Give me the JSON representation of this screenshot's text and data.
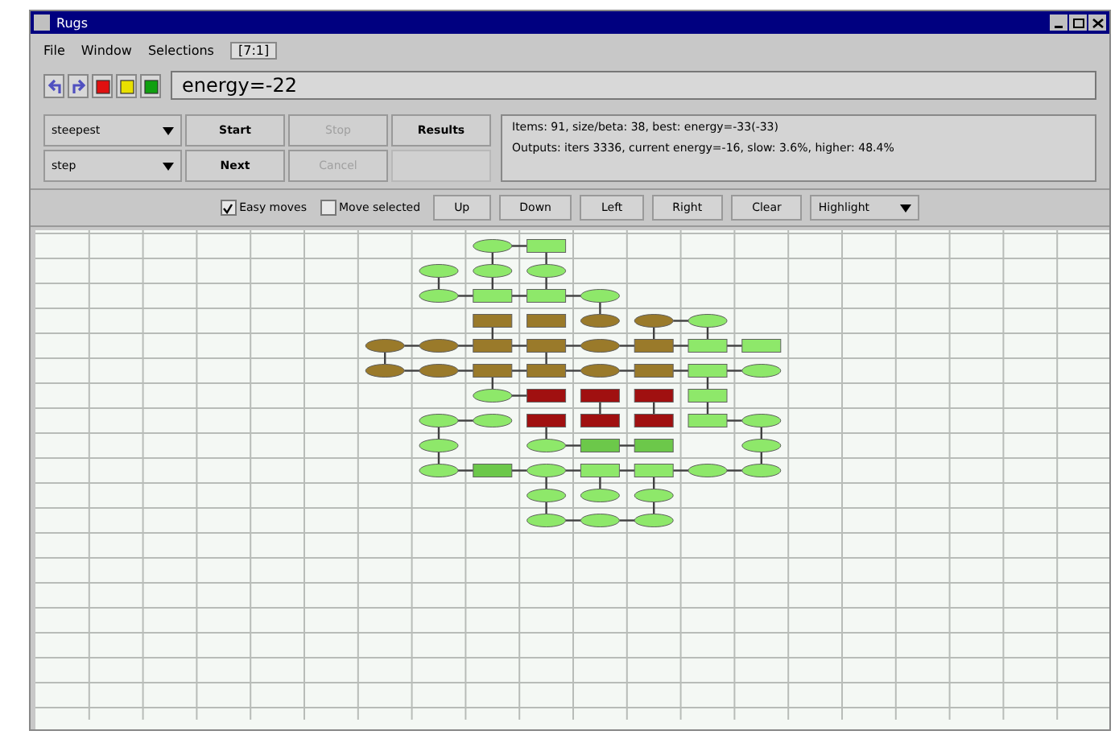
{
  "window": {
    "title": "Rugs"
  },
  "menu": [
    {
      "label": "File"
    },
    {
      "label": "Window"
    },
    {
      "label": "Selections"
    }
  ],
  "indicator": "[7:1]",
  "toolbar": {
    "energy": "energy=-22"
  },
  "controls": {
    "method": "steepest",
    "mode": "step",
    "buttons": [
      {
        "label": "Start",
        "disabled": false
      },
      {
        "label": "Stop",
        "disabled": true
      },
      {
        "label": "Results",
        "disabled": false
      },
      {
        "label": "Next",
        "disabled": false
      },
      {
        "label": "Cancel",
        "disabled": true
      }
    ],
    "info": [
      "Items: 91, size/beta: 38, best: energy=-33(-33)",
      "Outputs: iters 3336, current energy=-16, slow: 3.6%, higher: 48.4%"
    ]
  },
  "options": [
    {
      "label": "Easy moves",
      "checked": true
    },
    {
      "label": "Move selected",
      "checked": false
    }
  ],
  "moves": [
    "Up",
    "Down",
    "Left",
    "Right",
    "Clear"
  ],
  "highlight": "Highlight",
  "board": {
    "rows": [
      {
        "cells": [
          {
            "kind": "empty"
          },
          {
            "kind": "empty"
          },
          {
            "kind": "ellipse",
            "color": "#8ee86a",
            "link_right": true,
            "link_down": true
          },
          {
            "kind": "rect",
            "color": "#8ee86a",
            "link_right": false,
            "link_down": true
          },
          {
            "kind": "empty"
          },
          {
            "kind": "empty"
          },
          {
            "kind": "empty"
          },
          {
            "kind": "empty"
          }
        ]
      },
      {
        "cells": [
          {
            "kind": "empty"
          },
          {
            "kind": "ellipse",
            "color": "#8ee86a",
            "link_right": false,
            "link_down": true
          },
          {
            "kind": "ellipse",
            "color": "#8ee86a",
            "link_right": false,
            "link_down": true
          },
          {
            "kind": "ellipse",
            "color": "#8ee86a",
            "link_right": false,
            "link_down": true
          },
          {
            "kind": "empty"
          },
          {
            "kind": "empty"
          },
          {
            "kind": "empty"
          },
          {
            "kind": "empty"
          }
        ]
      },
      {
        "cells": [
          {
            "kind": "empty"
          },
          {
            "kind": "ellipse",
            "color": "#8ee86a",
            "link_right": true,
            "link_down": false
          },
          {
            "kind": "rect",
            "color": "#8ee86a",
            "link_right": true,
            "link_down": false
          },
          {
            "kind": "rect",
            "color": "#8ee86a",
            "link_right": true,
            "link_down": false
          },
          {
            "kind": "ellipse",
            "color": "#8ee86a",
            "link_right": false,
            "link_down": true
          },
          {
            "kind": "empty"
          },
          {
            "kind": "empty"
          },
          {
            "kind": "empty"
          }
        ]
      },
      {
        "cells": [
          {
            "kind": "empty"
          },
          {
            "kind": "empty"
          },
          {
            "kind": "rect",
            "color": "#9a7a2a",
            "link_right": false,
            "link_down": true
          },
          {
            "kind": "rect",
            "color": "#9a7a2a",
            "link_right": false,
            "link_down": false
          },
          {
            "kind": "ellipse",
            "color": "#9a7a2a",
            "link_right": false,
            "link_down": false
          },
          {
            "kind": "ellipse",
            "color": "#9a7a2a",
            "link_right": true,
            "link_down": true
          },
          {
            "kind": "ellipse",
            "color": "#8ee86a",
            "link_right": false,
            "link_down": true
          },
          {
            "kind": "empty"
          }
        ]
      },
      {
        "cells": [
          {
            "kind": "ellipse",
            "color": "#9a7a2a",
            "link_right": true,
            "link_down": true
          },
          {
            "kind": "ellipse",
            "color": "#9a7a2a",
            "link_right": true,
            "link_down": false
          },
          {
            "kind": "rect",
            "color": "#9a7a2a",
            "link_right": true,
            "link_down": false
          },
          {
            "kind": "rect",
            "color": "#9a7a2a",
            "link_right": true,
            "link_down": true
          },
          {
            "kind": "ellipse",
            "color": "#9a7a2a",
            "link_right": true,
            "link_down": false
          },
          {
            "kind": "rect",
            "color": "#9a7a2a",
            "link_right": true,
            "link_down": false
          },
          {
            "kind": "rect",
            "color": "#8ee86a",
            "link_right": true,
            "link_down": false
          },
          {
            "kind": "rect",
            "color": "#8ee86a",
            "link_right": false,
            "link_down": false
          }
        ]
      },
      {
        "cells": [
          {
            "kind": "ellipse",
            "color": "#9a7a2a",
            "link_right": true,
            "link_down": false
          },
          {
            "kind": "ellipse",
            "color": "#9a7a2a",
            "link_right": true,
            "link_down": false
          },
          {
            "kind": "rect",
            "color": "#9a7a2a",
            "link_right": true,
            "link_down": true
          },
          {
            "kind": "rect",
            "color": "#9a7a2a",
            "link_right": true,
            "link_down": false
          },
          {
            "kind": "ellipse",
            "color": "#9a7a2a",
            "link_right": true,
            "link_down": false
          },
          {
            "kind": "rect",
            "color": "#9a7a2a",
            "link_right": true,
            "link_down": false
          },
          {
            "kind": "rect",
            "color": "#8ee86a",
            "link_right": true,
            "link_down": true
          },
          {
            "kind": "ellipse",
            "color": "#8ee86a",
            "link_right": false,
            "link_down": false
          }
        ]
      },
      {
        "cells": [
          {
            "kind": "empty"
          },
          {
            "kind": "empty"
          },
          {
            "kind": "ellipse",
            "color": "#8ee86a",
            "link_right": true,
            "link_down": false
          },
          {
            "kind": "rect",
            "color": "#a01010",
            "link_right": false,
            "link_down": false
          },
          {
            "kind": "rect",
            "color": "#a01010",
            "link_right": false,
            "link_down": true
          },
          {
            "kind": "rect",
            "color": "#a01010",
            "link_right": false,
            "link_down": true
          },
          {
            "kind": "rect",
            "color": "#8ee86a",
            "link_right": false,
            "link_down": true
          },
          {
            "kind": "empty"
          }
        ]
      },
      {
        "cells": [
          {
            "kind": "empty"
          },
          {
            "kind": "ellipse",
            "color": "#8ee86a",
            "link_right": true,
            "link_down": true
          },
          {
            "kind": "ellipse",
            "color": "#8ee86a",
            "link_right": false,
            "link_down": false
          },
          {
            "kind": "rect",
            "color": "#a01010",
            "link_right": false,
            "link_down": true
          },
          {
            "kind": "rect",
            "color": "#a01010",
            "link_right": false,
            "link_down": false
          },
          {
            "kind": "rect",
            "color": "#a01010",
            "link_right": false,
            "link_down": false
          },
          {
            "kind": "rect",
            "color": "#8ee86a",
            "link_right": true,
            "link_down": false
          },
          {
            "kind": "ellipse",
            "color": "#8ee86a",
            "link_right": false,
            "link_down": true
          }
        ]
      },
      {
        "cells": [
          {
            "kind": "empty"
          },
          {
            "kind": "ellipse",
            "color": "#8ee86a",
            "link_right": false,
            "link_down": true
          },
          {
            "kind": "empty"
          },
          {
            "kind": "ellipse",
            "color": "#8ee86a",
            "link_right": true,
            "link_down": false
          },
          {
            "kind": "rect",
            "color": "#6cc84a",
            "link_right": true,
            "link_down": false
          },
          {
            "kind": "rect",
            "color": "#6cc84a",
            "link_right": false,
            "link_down": false
          },
          {
            "kind": "empty"
          },
          {
            "kind": "ellipse",
            "color": "#8ee86a",
            "link_right": false,
            "link_down": true
          }
        ]
      },
      {
        "cells": [
          {
            "kind": "empty"
          },
          {
            "kind": "ellipse",
            "color": "#8ee86a",
            "link_right": true,
            "link_down": false
          },
          {
            "kind": "rect",
            "color": "#6cc84a",
            "link_right": true,
            "link_down": false
          },
          {
            "kind": "ellipse",
            "color": "#8ee86a",
            "link_right": true,
            "link_down": true
          },
          {
            "kind": "rect",
            "color": "#8ee86a",
            "link_right": true,
            "link_down": true
          },
          {
            "kind": "rect",
            "color": "#8ee86a",
            "link_right": true,
            "link_down": true
          },
          {
            "kind": "ellipse",
            "color": "#8ee86a",
            "link_right": true,
            "link_down": false
          },
          {
            "kind": "ellipse",
            "color": "#8ee86a",
            "link_right": false,
            "link_down": false
          }
        ]
      },
      {
        "cells": [
          {
            "kind": "empty"
          },
          {
            "kind": "empty"
          },
          {
            "kind": "empty"
          },
          {
            "kind": "ellipse",
            "color": "#8ee86a",
            "link_right": false,
            "link_down": true
          },
          {
            "kind": "ellipse",
            "color": "#8ee86a",
            "link_right": false,
            "link_down": false
          },
          {
            "kind": "ellipse",
            "color": "#8ee86a",
            "link_right": false,
            "link_down": true
          },
          {
            "kind": "empty"
          },
          {
            "kind": "empty"
          }
        ]
      },
      {
        "cells": [
          {
            "kind": "empty"
          },
          {
            "kind": "empty"
          },
          {
            "kind": "empty"
          },
          {
            "kind": "ellipse",
            "color": "#8ee86a",
            "link_right": true,
            "link_down": false
          },
          {
            "kind": "ellipse",
            "color": "#8ee86a",
            "link_right": true,
            "link_down": false
          },
          {
            "kind": "ellipse",
            "color": "#8ee86a",
            "link_right": false,
            "link_down": false
          },
          {
            "kind": "empty"
          },
          {
            "kind": "empty"
          }
        ]
      }
    ]
  }
}
